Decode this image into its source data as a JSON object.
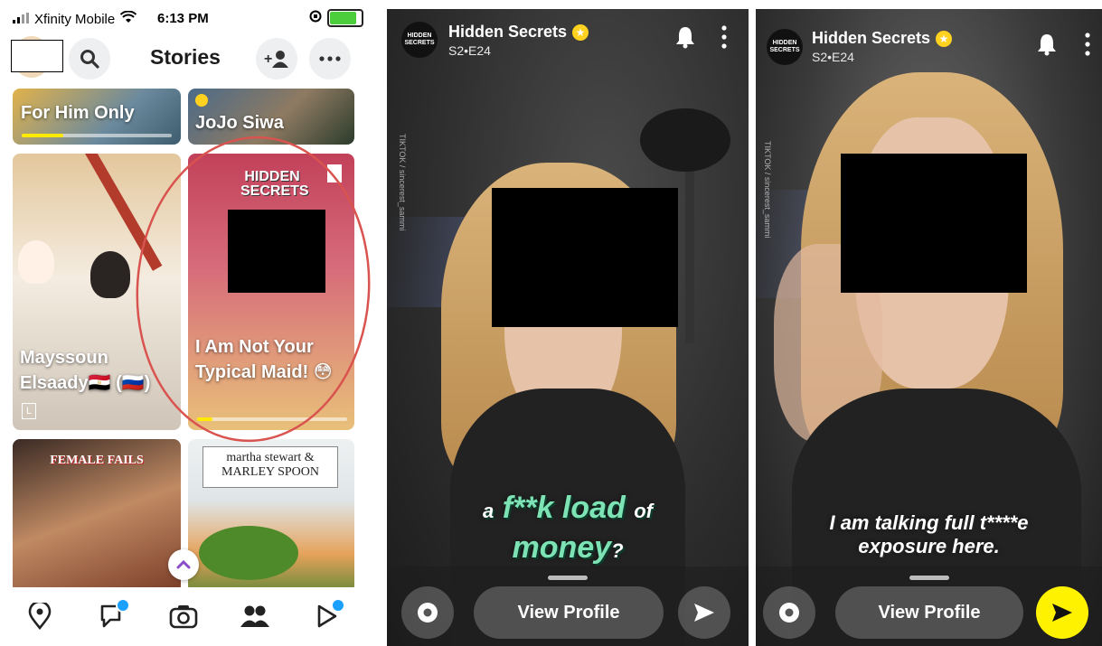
{
  "status_bar": {
    "carrier": "Xfinity Mobile",
    "time": "6:13 PM"
  },
  "header": {
    "title": "Stories"
  },
  "tiles": [
    {
      "title": "For Him Only",
      "progress": 0.28
    },
    {
      "title": "JoJo Siwa"
    },
    {
      "title": "Mayssoun Elsaady🇪🇬 (🇷🇺)",
      "badge": "L"
    },
    {
      "title": "I Am Not Your Typical Maid! 😳",
      "brand": "HIDDEN SECRETS",
      "progress": 0.1
    },
    {
      "title": "FEMALE FAILS"
    },
    {
      "title": "martha stewart & MARLEY SPOON"
    }
  ],
  "nav": {
    "icons": [
      "map-pin-icon",
      "chat-icon",
      "camera-icon",
      "friends-icon",
      "play-icon"
    ],
    "badge_color": "#1aa0ff"
  },
  "stories": [
    {
      "channel": "Hidden Secrets",
      "episode": "S2•E24",
      "logo_text": "HIDDEN SECRETS",
      "watermark": "TIKTOK / sincerest_sammi",
      "caption_parts": [
        "a",
        "f**k load",
        "of",
        "money",
        "?"
      ],
      "view_profile": "View Profile"
    },
    {
      "channel": "Hidden Secrets",
      "episode": "S2•E24",
      "logo_text": "HIDDEN SECRETS",
      "watermark": "TIKTOK / sincerest_sammi",
      "caption_line1": "I am talking full t****e",
      "caption_line2": "exposure here.",
      "view_profile": "View Profile"
    }
  ],
  "colors": {
    "accent_yellow": "#ffea00",
    "caption_green": "#7de3b5",
    "send_yellow": "#fff200",
    "annotation_red": "#d9534f"
  }
}
